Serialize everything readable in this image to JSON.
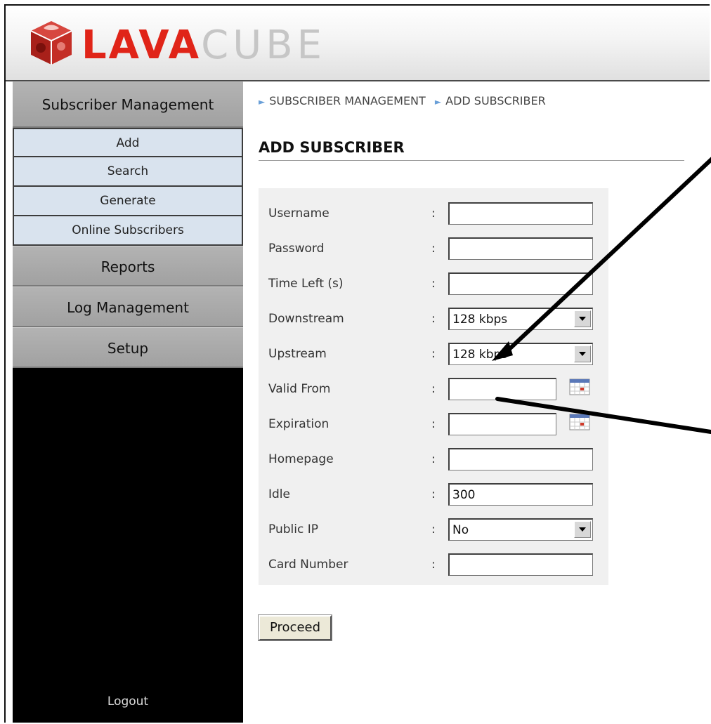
{
  "brand": {
    "part1": "LAVA",
    "part2": "CUBE"
  },
  "sidebar": {
    "sections": [
      {
        "label": "Subscriber Management"
      },
      {
        "label": "Reports"
      },
      {
        "label": "Log Management"
      },
      {
        "label": "Setup"
      }
    ],
    "subitems": [
      {
        "label": "Add"
      },
      {
        "label": "Search"
      },
      {
        "label": "Generate"
      },
      {
        "label": "Online Subscribers"
      }
    ],
    "logout": "Logout"
  },
  "breadcrumb": {
    "item1": "SUBSCRIBER MANAGEMENT",
    "item2": "ADD SUBSCRIBER"
  },
  "page": {
    "title": "ADD SUBSCRIBER"
  },
  "form": {
    "colon": ":",
    "fields": [
      {
        "label": "Username",
        "value": ""
      },
      {
        "label": "Password",
        "value": ""
      },
      {
        "label": "Time Left (s)",
        "value": ""
      },
      {
        "label": "Downstream",
        "value": "128 kbps"
      },
      {
        "label": "Upstream",
        "value": "128 kbps"
      },
      {
        "label": "Valid From",
        "value": ""
      },
      {
        "label": "Expiration",
        "value": ""
      },
      {
        "label": "Homepage",
        "value": ""
      },
      {
        "label": "Idle",
        "value": "300"
      },
      {
        "label": "Public IP",
        "value": "No"
      },
      {
        "label": "Card Number",
        "value": ""
      }
    ],
    "proceed_label": "Proceed"
  },
  "colors": {
    "brand_red": "#e02418",
    "sidebar_bg": "#000000",
    "subitem_bg": "#d9e3ee",
    "form_bg": "#f0f0f0"
  }
}
